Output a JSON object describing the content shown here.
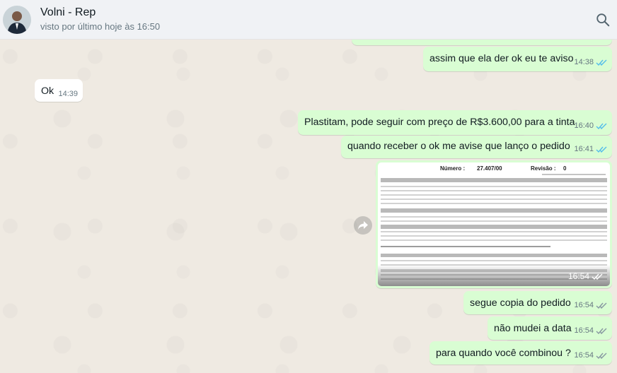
{
  "header": {
    "contact_name": "Volni - Rep",
    "contact_status": "visto por último hoje às 16:50"
  },
  "messages": [
    {
      "direction": "out",
      "text": "assim que ela der ok eu te aviso",
      "time": "14:38",
      "status": "read"
    },
    {
      "direction": "in",
      "text": "Ok",
      "time": "14:39"
    },
    {
      "direction": "out",
      "text": "Plastitam, pode seguir com preço de R$3.600,00 para a tinta",
      "time": "16:40",
      "status": "read"
    },
    {
      "direction": "out",
      "text": "quando receber o ok me avise que lanço o pedido",
      "time": "16:41",
      "status": "read"
    },
    {
      "direction": "out",
      "type": "image",
      "time": "16:54",
      "status": "delivered",
      "image": {
        "numero_label": "Número :",
        "numero_value": "27.407/00",
        "revisao_label": "Revisão :",
        "revisao_value": "0"
      }
    },
    {
      "direction": "out",
      "text": "segue copia do pedido",
      "time": "16:54",
      "status": "delivered"
    },
    {
      "direction": "out",
      "text": "não mudei a data",
      "time": "16:54",
      "status": "delivered"
    },
    {
      "direction": "out",
      "text": "para quando você combinou ?",
      "time": "16:54",
      "status": "delivered"
    }
  ],
  "colors": {
    "outgoing_bubble": "#d9fdd3",
    "incoming_bubble": "#ffffff",
    "read_tick": "#53bdeb",
    "delivered_tick": "#8696a0",
    "chat_background": "#efeae2"
  },
  "icons": {
    "search": "search-icon",
    "forward": "forward-icon",
    "avatar": "avatar"
  }
}
